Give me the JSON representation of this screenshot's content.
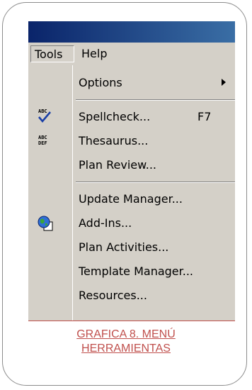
{
  "window": {
    "title": ""
  },
  "menubar": {
    "tools": "Tools",
    "help": "Help"
  },
  "menu": {
    "options": "Options",
    "spellcheck": "Spellcheck...",
    "spellcheck_shortcut": "F7",
    "thesaurus": "Thesaurus...",
    "plan_review": "Plan Review...",
    "update_manager": "Update Manager...",
    "add_ins": "Add-Ins...",
    "plan_activities": "Plan Activities...",
    "template_manager": "Template Manager...",
    "resources": "Resources..."
  },
  "icons": {
    "spellcheck": "abc-check-icon",
    "thesaurus": "abc-def-icon",
    "add_ins": "globe-icon"
  },
  "caption": {
    "line1": "GRAFICA 8. MENÚ",
    "line2": "HERRAMIENTAS"
  },
  "colors": {
    "caption": "#c0504d",
    "menu_bg": "#d4d0c8",
    "titlebar": "#0a246a"
  }
}
